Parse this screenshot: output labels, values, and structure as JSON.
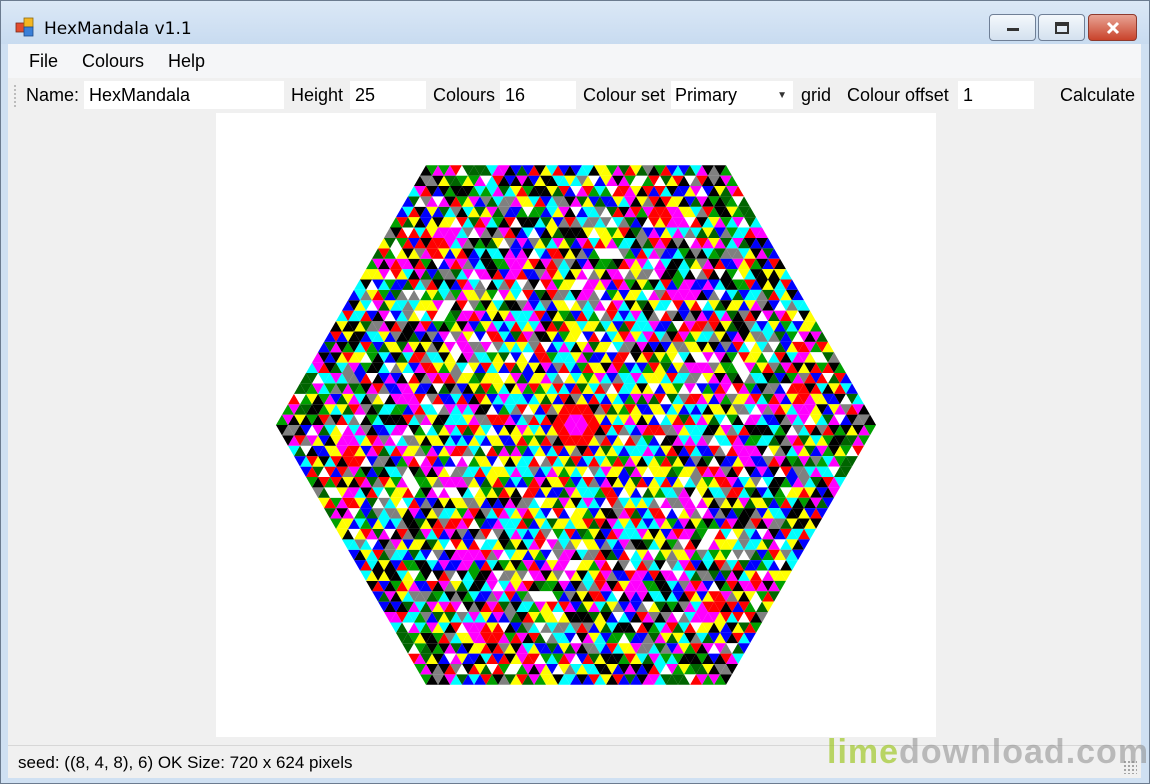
{
  "window": {
    "title": "HexMandala v1.1",
    "icon": "app-icon"
  },
  "menu": {
    "items": [
      "File",
      "Colours",
      "Help"
    ]
  },
  "toolbar": {
    "name_label": "Name:",
    "name_value": "HexMandala",
    "height_label": "Height",
    "height_value": "25",
    "colours_label": "Colours",
    "colours_value": "16",
    "colour_set_label": "Colour set",
    "colour_set_value": "Primary",
    "grid_label": "grid",
    "colour_offset_label": "Colour offset",
    "colour_offset_value": "1",
    "calculate_label": "Calculate"
  },
  "mandala": {
    "rows": 25,
    "palette": [
      "#ff0000",
      "#00a000",
      "#0000ff",
      "#ffff00",
      "#00ffff",
      "#ff00ff",
      "#000000",
      "#ffffff",
      "#808080",
      "#006400",
      "#ff00ff",
      "#ffff00",
      "#00ffff",
      "#ff0000",
      "#0000ff",
      "#000000"
    ]
  },
  "status": {
    "text": "seed: ((8, 4, 8), 6)  OK  Size: 720 x 624 pixels"
  },
  "watermark": {
    "part1": "lime",
    "part2": "download.com"
  }
}
